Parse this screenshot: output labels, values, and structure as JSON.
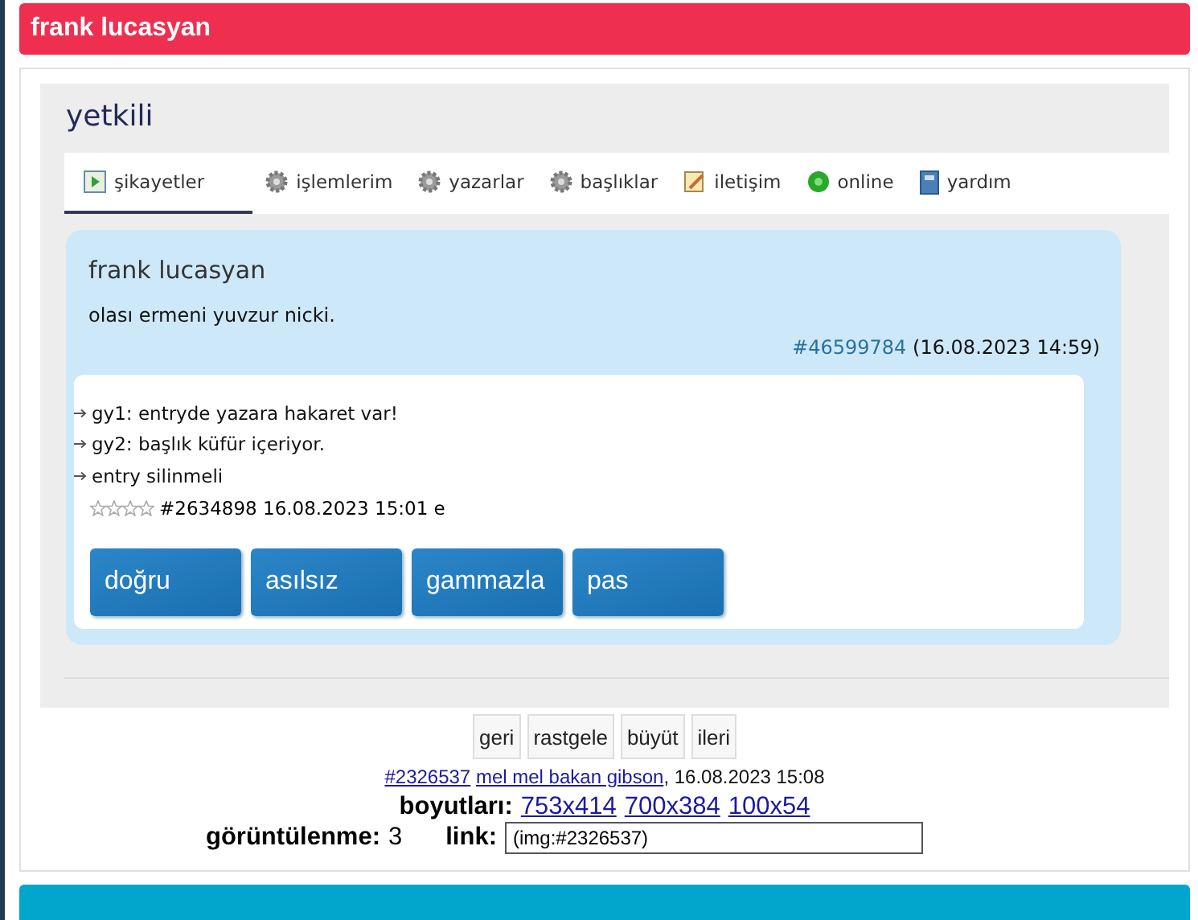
{
  "header": {
    "title": "frank lucasyan"
  },
  "screenshot": {
    "title": "yetkili",
    "tabs": [
      {
        "label": "şikayetler",
        "kind": "play",
        "selected": true
      },
      {
        "label": "işlemlerim",
        "kind": "gear",
        "selected": false
      },
      {
        "label": "yazarlar",
        "kind": "gear",
        "selected": false
      },
      {
        "label": "başlıklar",
        "kind": "gear",
        "selected": false
      },
      {
        "label": "iletişim",
        "kind": "note",
        "selected": false
      },
      {
        "label": "online",
        "kind": "dot",
        "selected": false
      },
      {
        "label": "yardım",
        "kind": "book",
        "selected": false
      }
    ],
    "complaint": {
      "user": "frank lucasyan",
      "text": "olası ermeni yuvzur nicki.",
      "ref": "#46599784",
      "date": "(16.08.2023 14:59)",
      "reasons": [
        "gy1: entryde yazara hakaret var!",
        "gy2: başlık küfür içeriyor.",
        "entry silinmeli"
      ],
      "stars": 0,
      "entry_meta": "#2634898 16.08.2023 15:01 e",
      "actions": [
        "doğru",
        "asılsız",
        "gammazla",
        "pas"
      ]
    }
  },
  "nav_buttons": [
    "geri",
    "rastgele",
    "büyüt",
    "ileri"
  ],
  "info": {
    "id": "#2326537",
    "author": "mel mel bakan gibson",
    "date": ", 16.08.2023 15:08"
  },
  "sizes": {
    "label": "boyutları:",
    "links": [
      "753x414",
      "700x384",
      "100x54"
    ]
  },
  "views": {
    "label": "görüntülenme:",
    "value": "3"
  },
  "link": {
    "label": "link:",
    "value": "(img:#2326537)"
  }
}
